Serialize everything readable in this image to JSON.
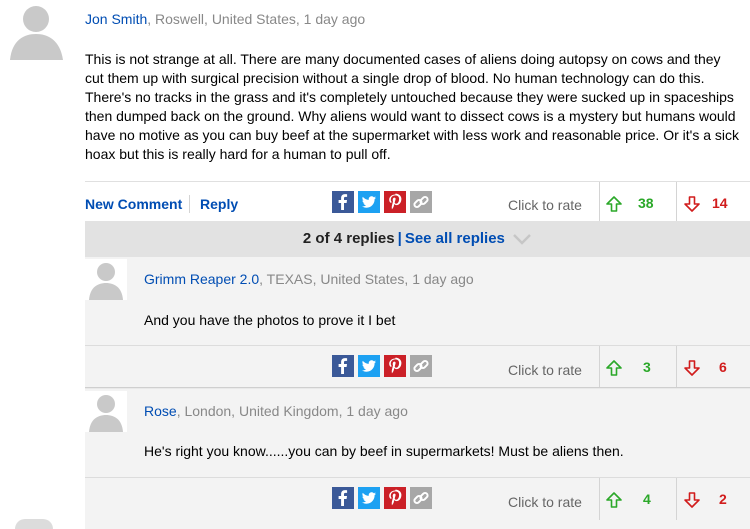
{
  "main_comment": {
    "author": "Jon Smith",
    "meta": ", Roswell, United States, 1 day ago",
    "body": "This is not strange at all. There are many documented cases of aliens doing autopsy on cows and they cut them up with surgical precision without a single drop of blood. No human technology can do this. There's no tracks in the grass and it's completely untouched because they were sucked up in spaceships then dumped back on the ground. Why aliens would want to dissect cows is a mystery but humans would have no motive as you can buy beef at the supermarket with less work and reasonable price. Or it's a sick hoax but this is really hard for a human to pull off.",
    "new_comment_label": "New Comment",
    "reply_label": "Reply",
    "rate_label": "Click to rate",
    "upvotes": "38",
    "downvotes": "14"
  },
  "replies_header": {
    "count_text": "2 of 4 replies",
    "divider": "|",
    "see_all_label": "See all replies"
  },
  "replies": [
    {
      "author": "Grimm Reaper 2.0",
      "meta": ", TEXAS, United States, 1 day ago",
      "body": "And you have the photos to prove it I bet",
      "rate_label": "Click to rate",
      "upvotes": "3",
      "downvotes": "6"
    },
    {
      "author": "Rose",
      "meta": ", London, United Kingdom, 1 day ago",
      "body": "He's right you know......you can by beef in supermarkets! Must be aliens then.",
      "rate_label": "Click to rate",
      "upvotes": "4",
      "downvotes": "2"
    }
  ],
  "share_icons": [
    "facebook-icon",
    "twitter-icon",
    "pinterest-icon",
    "link-icon"
  ],
  "colors": {
    "link_blue": "#004db3",
    "upvote_green": "#2ba829",
    "downvote_red": "#d11c1c",
    "facebook": "#3b5998",
    "twitter": "#1da1f2",
    "pinterest": "#cb2027",
    "share_link": "#a7a7a7"
  }
}
